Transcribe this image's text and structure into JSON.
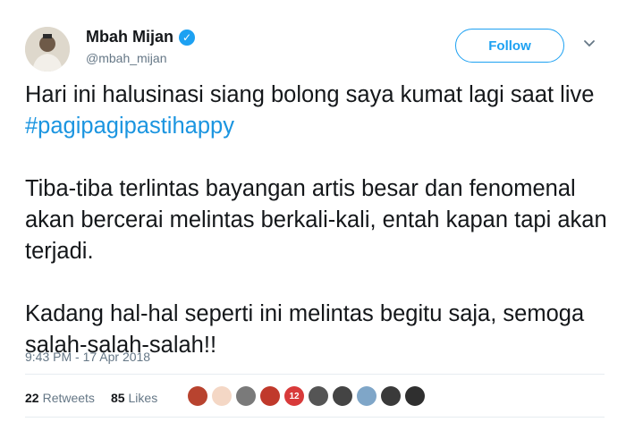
{
  "user": {
    "display_name": "Mbah Mijan",
    "handle": "@mbah_mijan",
    "verified_glyph": "✓"
  },
  "follow_button": {
    "label": "Follow"
  },
  "tweet": {
    "para1_text": "Hari ini halusinasi siang bolong saya kumat lagi saat live ",
    "para1_hashtag": "#pagipagipastihappy",
    "para2": "Tiba-tiba terlintas bayangan artis besar dan fenomenal akan bercerai melintas berkali-kali, entah kapan tapi akan terjadi.",
    "para3": "Kadang hal-hal seperti ini melintas begitu saja, semoga salah-salah-salah!!"
  },
  "timestamp": "9:43 PM - 17 Apr 2018",
  "stats": {
    "retweets_count": "22",
    "retweets_label": "Retweets",
    "likes_count": "85",
    "likes_label": "Likes"
  },
  "likers": [
    {
      "color": "#b8432f",
      "badge": ""
    },
    {
      "color": "#f4d7c5",
      "badge": ""
    },
    {
      "color": "#7a7a7a",
      "badge": ""
    },
    {
      "color": "#c0392b",
      "badge": ""
    },
    {
      "color": "#d83a3a",
      "badge": "12"
    },
    {
      "color": "#555555",
      "badge": ""
    },
    {
      "color": "#444444",
      "badge": ""
    },
    {
      "color": "#7fa6c8",
      "badge": ""
    },
    {
      "color": "#3a3a3a",
      "badge": ""
    },
    {
      "color": "#2f2f2f",
      "badge": ""
    }
  ],
  "colors": {
    "accent": "#1da1f2",
    "hashtag": "#1b95e0",
    "secondary_text": "#657786"
  }
}
